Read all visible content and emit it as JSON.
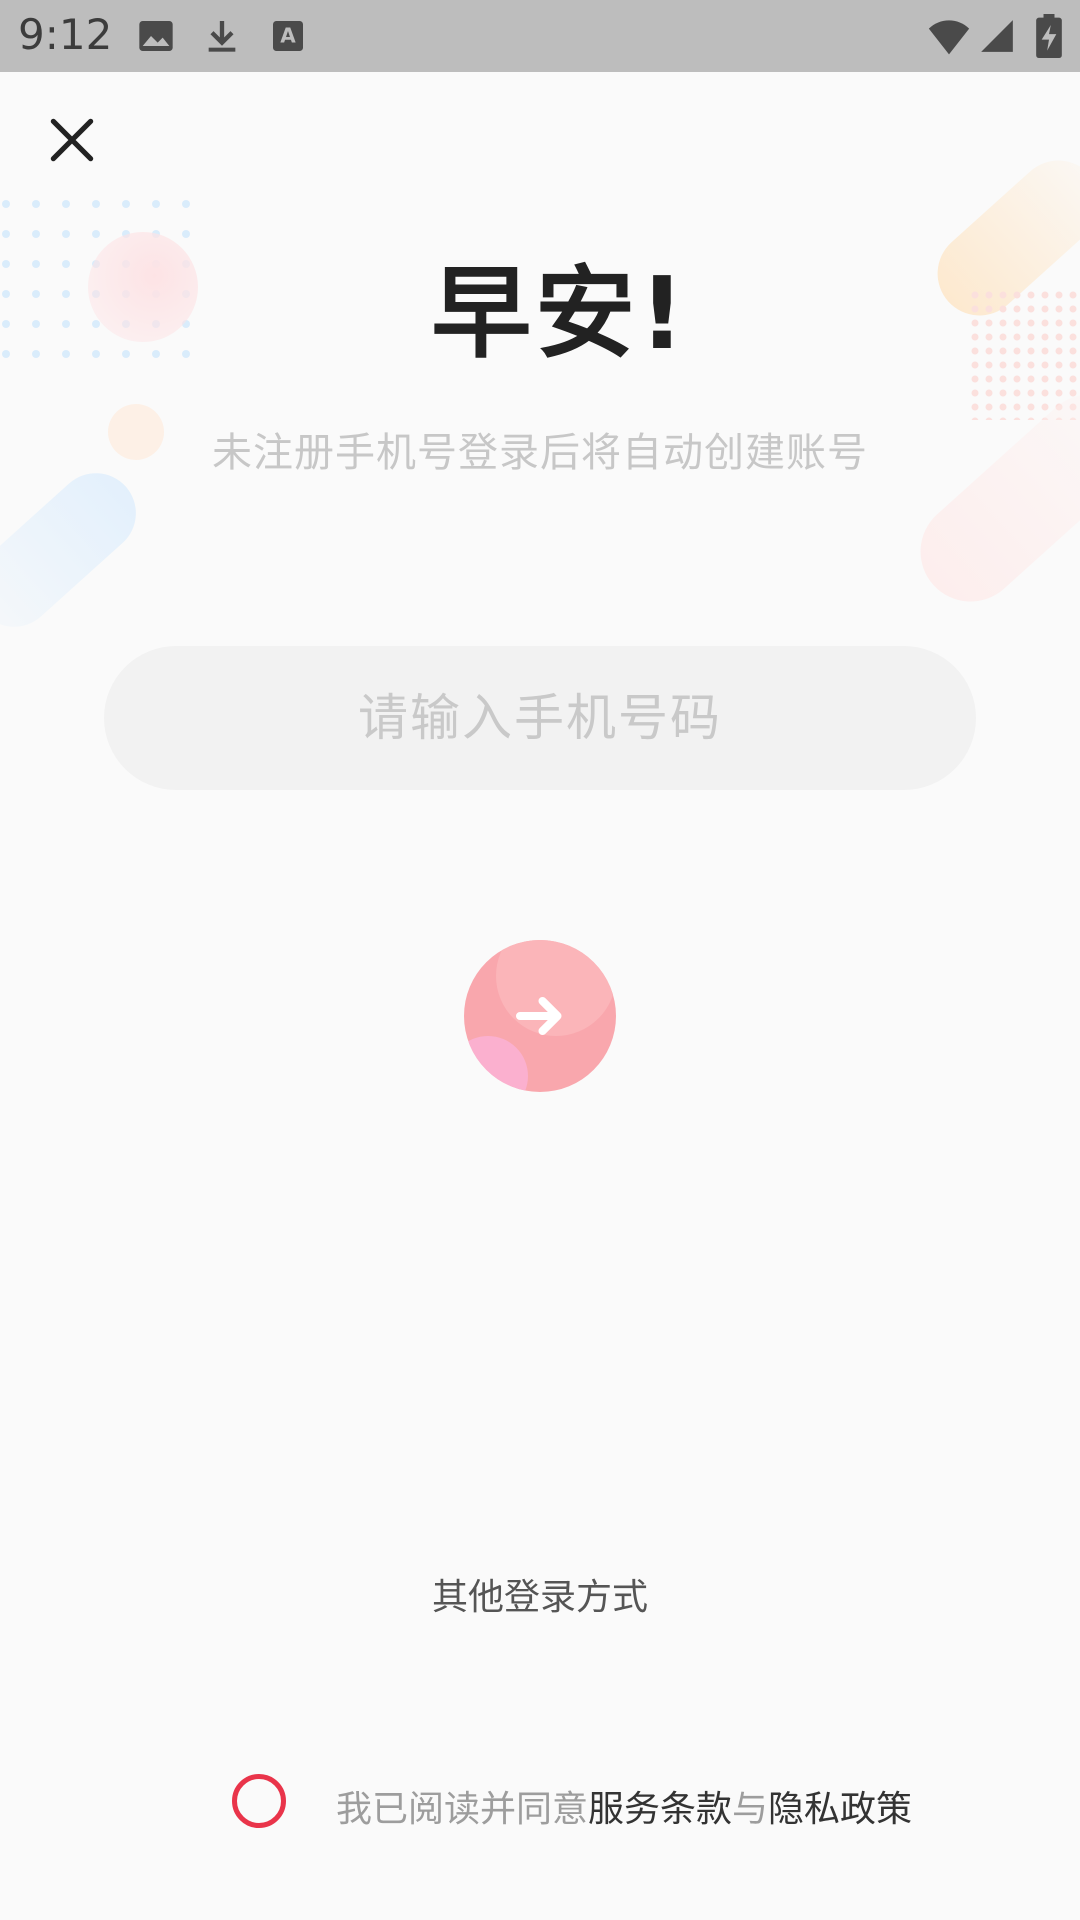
{
  "status_bar": {
    "time": "9:12",
    "left_icons": [
      "image-icon",
      "download-icon",
      "keyboard-a-icon"
    ],
    "right_icons": [
      "wifi-icon",
      "cell-signal-icon",
      "battery-charging-icon"
    ]
  },
  "close": {
    "icon": "close-icon"
  },
  "greeting": "早安!",
  "subtitle": "未注册手机号登录后将自动创建账号",
  "phone_input": {
    "value": "",
    "placeholder": "请输入手机号码"
  },
  "submit": {
    "icon": "arrow-right-icon",
    "color": "#f9a7ad"
  },
  "other_login_label": "其他登录方式",
  "agreement": {
    "checked": false,
    "prefix": "我已阅读并同意",
    "terms_link": "服务条款",
    "conjunction": "与",
    "privacy_link": "隐私政策",
    "radio_color": "#e9344a"
  }
}
